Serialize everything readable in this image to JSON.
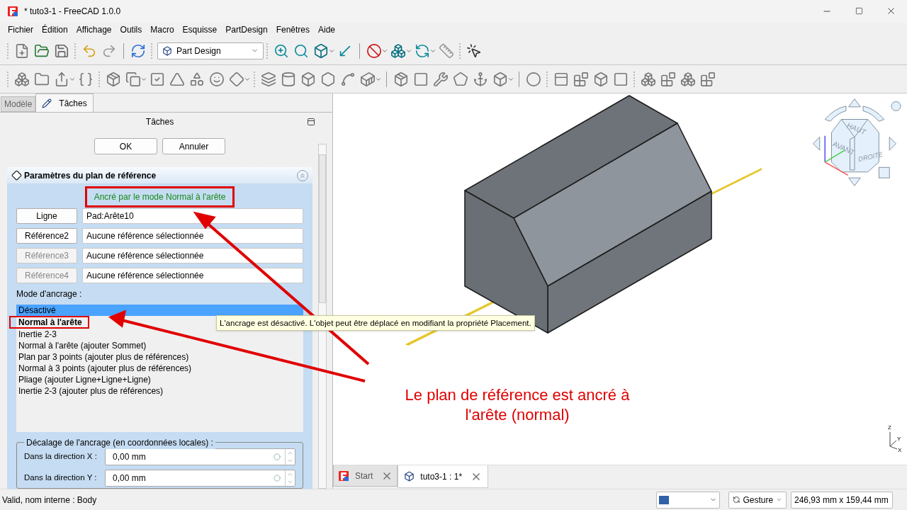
{
  "window": {
    "title": "* tuto3-1 - FreeCAD 1.0.0"
  },
  "menu": [
    "Fichier",
    "Édition",
    "Affichage",
    "Outils",
    "Macro",
    "Esquisse",
    "PartDesign",
    "Fenêtres",
    "Aide"
  ],
  "workbench": {
    "value": "Part Design"
  },
  "side_tabs": [
    {
      "label": "Modèle",
      "selected": false
    },
    {
      "label": "Tâches",
      "selected": true
    }
  ],
  "panel": {
    "title": "Tâches",
    "buttons": [
      "OK",
      "Annuler"
    ],
    "section": {
      "title": "Paramètres du plan de référence",
      "status": "Ancré par le mode Normal à l'arête",
      "status_highlighted": true,
      "references": [
        {
          "button": "Ligne",
          "value": "Pad:Arête10",
          "disabled": false
        },
        {
          "button": "Référence2",
          "value": "Aucune référence sélectionnée",
          "disabled": false
        },
        {
          "button": "Référence3",
          "value": "Aucune référence sélectionnée",
          "disabled": true
        },
        {
          "button": "Référence4",
          "value": "Aucune référence sélectionnée",
          "disabled": true
        }
      ],
      "mode_label": "Mode d'ancrage :",
      "modes": [
        {
          "label": "Désactivé",
          "selected": true,
          "bold": false,
          "highlighted": false
        },
        {
          "label": "Normal à l'arête",
          "selected": false,
          "bold": true,
          "highlighted": true
        },
        {
          "label": "Inertie 2-3",
          "selected": false,
          "bold": false,
          "highlighted": false
        },
        {
          "label": "Normal à l'arête (ajouter Sommet)",
          "selected": false,
          "bold": false,
          "highlighted": false
        },
        {
          "label": "Plan par 3 points (ajouter plus de références)",
          "selected": false,
          "bold": false,
          "highlighted": false
        },
        {
          "label": "Normal à 3 points (ajouter plus de références)",
          "selected": false,
          "bold": false,
          "highlighted": false
        },
        {
          "label": "Pliage (ajouter Ligne+Ligne+Ligne)",
          "selected": false,
          "bold": false,
          "highlighted": false
        },
        {
          "label": "Inertie 2-3 (ajouter plus de références)",
          "selected": false,
          "bold": false,
          "highlighted": false
        }
      ],
      "offset": {
        "title": "Décalage de l'ancrage (en coordonnées locales) :",
        "fields": [
          {
            "label": "Dans la direction X :",
            "value": "0,00 mm"
          },
          {
            "label": "Dans la direction Y :",
            "value": "0,00 mm"
          }
        ]
      }
    }
  },
  "tooltip": "L'ancrage est désactivé. L'objet peut être déplacé en modifiant la propriété Placement.",
  "annotation": "Le plan de référence est ancré à l'arête (normal)",
  "nav_cube": {
    "faces": [
      "HAUT",
      "AVANT",
      "DROITE"
    ]
  },
  "axes": [
    "Z",
    "Y",
    "X"
  ],
  "doc_tabs": [
    {
      "label": "Start",
      "selected": false
    },
    {
      "label": "tuto3-1 : 1*",
      "selected": true
    }
  ],
  "status_bar": {
    "message": "Valid, nom interne : Body",
    "navigation": "Gesture",
    "dimensions": "246,93 mm x 159,44 mm"
  }
}
